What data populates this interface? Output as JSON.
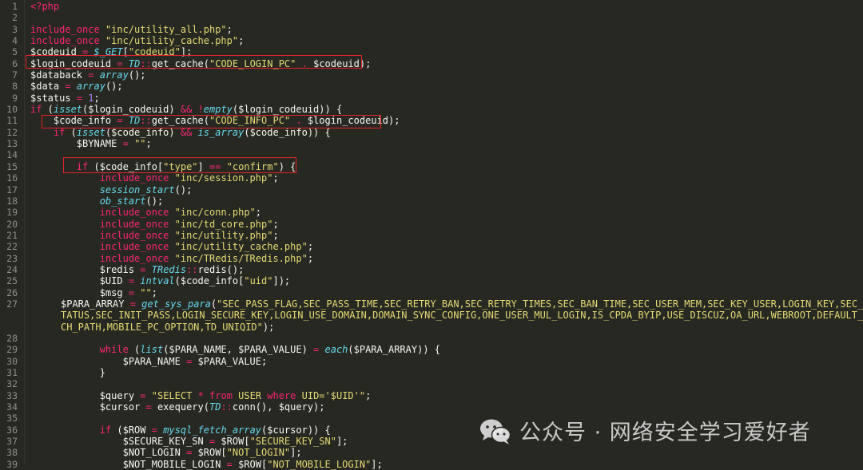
{
  "editor": {
    "language": "php",
    "lines": [
      {
        "n": "1",
        "tokens": [
          [
            "kw",
            "<?php"
          ]
        ]
      },
      {
        "n": "2",
        "tokens": []
      },
      {
        "n": "3",
        "tokens": [
          [
            "kw",
            "include_once"
          ],
          [
            "var",
            " "
          ],
          [
            "st",
            "\"inc/utility_all.php\""
          ],
          [
            "var",
            ";"
          ]
        ]
      },
      {
        "n": "4",
        "tokens": [
          [
            "kw",
            "include_once"
          ],
          [
            "var",
            " "
          ],
          [
            "st",
            "\"inc/utility_cache.php\""
          ],
          [
            "var",
            ";"
          ]
        ]
      },
      {
        "n": "5",
        "tokens": [
          [
            "var",
            "$codeuid "
          ],
          [
            "kw",
            "="
          ],
          [
            "var",
            " "
          ],
          [
            "fn",
            "$_GET"
          ],
          [
            "var",
            "["
          ],
          [
            "st",
            "\"codeuid\""
          ],
          [
            "var",
            "];"
          ]
        ]
      },
      {
        "n": "6",
        "tokens": [
          [
            "var",
            "$login_codeuid "
          ],
          [
            "kw",
            "="
          ],
          [
            "var",
            " "
          ],
          [
            "fn",
            "TD"
          ],
          [
            "kw",
            "::"
          ],
          [
            "var",
            "get_cache("
          ],
          [
            "st",
            "\"CODE_LOGIN_PC\""
          ],
          [
            "var",
            " "
          ],
          [
            "kw",
            "."
          ],
          [
            "var",
            " $codeuid);"
          ]
        ]
      },
      {
        "n": "7",
        "tokens": [
          [
            "var",
            "$databack "
          ],
          [
            "kw",
            "="
          ],
          [
            "var",
            " "
          ],
          [
            "fn",
            "array"
          ],
          [
            "var",
            "();"
          ]
        ]
      },
      {
        "n": "8",
        "tokens": [
          [
            "var",
            "$data "
          ],
          [
            "kw",
            "="
          ],
          [
            "var",
            " "
          ],
          [
            "fn",
            "array"
          ],
          [
            "var",
            "();"
          ]
        ]
      },
      {
        "n": "9",
        "tokens": [
          [
            "var",
            "$status "
          ],
          [
            "kw",
            "="
          ],
          [
            "var",
            " "
          ],
          [
            "nu",
            "1"
          ],
          [
            "var",
            ";"
          ]
        ]
      },
      {
        "n": "10",
        "tokens": [
          [
            "kw",
            "if"
          ],
          [
            "var",
            " ("
          ],
          [
            "fn",
            "isset"
          ],
          [
            "var",
            "($login_codeuid) "
          ],
          [
            "kw",
            "&&"
          ],
          [
            "var",
            " "
          ],
          [
            "kw",
            "!"
          ],
          [
            "fn",
            "empty"
          ],
          [
            "var",
            "($login_codeuid)) {"
          ]
        ]
      },
      {
        "n": "11",
        "tokens": [
          [
            "var",
            "    $code_info "
          ],
          [
            "kw",
            "="
          ],
          [
            "var",
            " "
          ],
          [
            "fn",
            "TD"
          ],
          [
            "kw",
            "::"
          ],
          [
            "var",
            "get_cache("
          ],
          [
            "st",
            "\"CODE_INFO_PC\""
          ],
          [
            "var",
            " "
          ],
          [
            "kw",
            "."
          ],
          [
            "var",
            " $login_codeuid);"
          ]
        ]
      },
      {
        "n": "12",
        "tokens": [
          [
            "var",
            "    "
          ],
          [
            "kw",
            "if"
          ],
          [
            "var",
            " ("
          ],
          [
            "fn",
            "isset"
          ],
          [
            "var",
            "($code_info) "
          ],
          [
            "kw",
            "&&"
          ],
          [
            "var",
            " "
          ],
          [
            "fn",
            "is_array"
          ],
          [
            "var",
            "($code_info)) {"
          ]
        ]
      },
      {
        "n": "13",
        "tokens": [
          [
            "var",
            "        $BYNAME "
          ],
          [
            "kw",
            "="
          ],
          [
            "var",
            " "
          ],
          [
            "st",
            "\"\""
          ],
          [
            "var",
            ";"
          ]
        ]
      },
      {
        "n": "14",
        "tokens": []
      },
      {
        "n": "15",
        "tokens": [
          [
            "var",
            "        "
          ],
          [
            "kw",
            "if"
          ],
          [
            "var",
            " ($code_info["
          ],
          [
            "st",
            "\"type\""
          ],
          [
            "var",
            "] "
          ],
          [
            "kw",
            "=="
          ],
          [
            "var",
            " "
          ],
          [
            "st",
            "\"confirm\""
          ],
          [
            "var",
            ") {"
          ]
        ]
      },
      {
        "n": "16",
        "tokens": [
          [
            "var",
            "            "
          ],
          [
            "kw",
            "include_once"
          ],
          [
            "var",
            " "
          ],
          [
            "st",
            "\"inc/session.php\""
          ],
          [
            "var",
            ";"
          ]
        ]
      },
      {
        "n": "17",
        "tokens": [
          [
            "var",
            "            "
          ],
          [
            "fn",
            "session_start"
          ],
          [
            "var",
            "();"
          ]
        ]
      },
      {
        "n": "18",
        "tokens": [
          [
            "var",
            "            "
          ],
          [
            "fn",
            "ob_start"
          ],
          [
            "var",
            "();"
          ]
        ]
      },
      {
        "n": "19",
        "tokens": [
          [
            "var",
            "            "
          ],
          [
            "kw",
            "include_once"
          ],
          [
            "var",
            " "
          ],
          [
            "st",
            "\"inc/conn.php\""
          ],
          [
            "var",
            ";"
          ]
        ]
      },
      {
        "n": "20",
        "tokens": [
          [
            "var",
            "            "
          ],
          [
            "kw",
            "include_once"
          ],
          [
            "var",
            " "
          ],
          [
            "st",
            "\"inc/td_core.php\""
          ],
          [
            "var",
            ";"
          ]
        ]
      },
      {
        "n": "21",
        "tokens": [
          [
            "var",
            "            "
          ],
          [
            "kw",
            "include_once"
          ],
          [
            "var",
            " "
          ],
          [
            "st",
            "\"inc/utility.php\""
          ],
          [
            "var",
            ";"
          ]
        ]
      },
      {
        "n": "22",
        "tokens": [
          [
            "var",
            "            "
          ],
          [
            "kw",
            "include_once"
          ],
          [
            "var",
            " "
          ],
          [
            "st",
            "\"inc/utility_cache.php\""
          ],
          [
            "var",
            ";"
          ]
        ]
      },
      {
        "n": "23",
        "tokens": [
          [
            "var",
            "            "
          ],
          [
            "kw",
            "include_once"
          ],
          [
            "var",
            " "
          ],
          [
            "st",
            "\"inc/TRedis/TRedis.php\""
          ],
          [
            "var",
            ";"
          ]
        ]
      },
      {
        "n": "24",
        "tokens": [
          [
            "var",
            "            $redis "
          ],
          [
            "kw",
            "="
          ],
          [
            "var",
            " "
          ],
          [
            "fn",
            "TRedis"
          ],
          [
            "kw",
            "::"
          ],
          [
            "var",
            "redis();"
          ]
        ]
      },
      {
        "n": "25",
        "tokens": [
          [
            "var",
            "            $UID "
          ],
          [
            "kw",
            "="
          ],
          [
            "var",
            " "
          ],
          [
            "fn",
            "intval"
          ],
          [
            "var",
            "($code_info["
          ],
          [
            "st",
            "\"uid\""
          ],
          [
            "var",
            "]);"
          ]
        ]
      },
      {
        "n": "26",
        "tokens": [
          [
            "var",
            "            $msg "
          ],
          [
            "kw",
            "="
          ],
          [
            "var",
            " "
          ],
          [
            "st",
            "\"\""
          ],
          [
            "var",
            ";"
          ]
        ]
      },
      {
        "n": "27",
        "wrap": true,
        "tokens": [
          [
            "var",
            "            $PARA_ARRAY "
          ],
          [
            "kw",
            "="
          ],
          [
            "var",
            " "
          ],
          [
            "fn",
            "get_sys_para"
          ],
          [
            "var",
            "("
          ],
          [
            "st",
            "\"SEC_PASS_FLAG,SEC_PASS_TIME,SEC_RETRY_BAN,SEC_RETRY_TIMES,SEC_BAN_TIME,SEC_USER_MEM,SEC_KEY_USER,LOGIN_KEY,SEC_ON_STATUS,SEC_INIT_PASS,LOGIN_SECURE_KEY,LOGIN_USE_DOMAIN,DOMAIN_SYNC_CONFIG,ONE_USER_MUL_LOGIN,IS_CPDA_BYIP,USE_DISCUZ,OA_URL,WEBROOT,DEFAULT_ATTACH_PATH,MOBILE_PC_OPTION,TD_UNIQID\""
          ],
          [
            "var",
            ");"
          ]
        ]
      },
      {
        "n": "28",
        "tokens": []
      },
      {
        "n": "29",
        "tokens": [
          [
            "var",
            "            "
          ],
          [
            "kw",
            "while"
          ],
          [
            "var",
            " ("
          ],
          [
            "fn",
            "list"
          ],
          [
            "var",
            "($PARA_NAME, $PARA_VALUE) "
          ],
          [
            "kw",
            "="
          ],
          [
            "var",
            " "
          ],
          [
            "fn",
            "each"
          ],
          [
            "var",
            "($PARA_ARRAY)) {"
          ]
        ]
      },
      {
        "n": "30",
        "tokens": [
          [
            "var",
            "                $PARA_NAME "
          ],
          [
            "kw",
            "="
          ],
          [
            "var",
            " $PARA_VALUE;"
          ]
        ]
      },
      {
        "n": "31",
        "tokens": [
          [
            "var",
            "            }"
          ]
        ]
      },
      {
        "n": "32",
        "tokens": []
      },
      {
        "n": "33",
        "tokens": [
          [
            "var",
            "            $query "
          ],
          [
            "kw",
            "="
          ],
          [
            "var",
            " "
          ],
          [
            "st",
            "\"SELECT "
          ],
          [
            "kw",
            "*"
          ],
          [
            "st",
            " "
          ],
          [
            "kw",
            "from"
          ],
          [
            "st",
            " USER "
          ],
          [
            "kw",
            "where"
          ],
          [
            "st",
            " UID='$UID'\""
          ],
          [
            "var",
            ";"
          ]
        ]
      },
      {
        "n": "34",
        "tokens": [
          [
            "var",
            "            $cursor "
          ],
          [
            "kw",
            "="
          ],
          [
            "var",
            " exequery("
          ],
          [
            "fn",
            "TD"
          ],
          [
            "kw",
            "::"
          ],
          [
            "var",
            "conn(), $query);"
          ]
        ]
      },
      {
        "n": "35",
        "tokens": []
      },
      {
        "n": "36",
        "tokens": [
          [
            "var",
            "            "
          ],
          [
            "kw",
            "if"
          ],
          [
            "var",
            " ($ROW "
          ],
          [
            "kw",
            "="
          ],
          [
            "var",
            " "
          ],
          [
            "fn",
            "mysql_fetch_array"
          ],
          [
            "var",
            "($cursor)) {"
          ]
        ]
      },
      {
        "n": "37",
        "tokens": [
          [
            "var",
            "                $SECURE_KEY_SN "
          ],
          [
            "kw",
            "="
          ],
          [
            "var",
            " $ROW["
          ],
          [
            "st",
            "\"SECURE_KEY_SN\""
          ],
          [
            "var",
            "];"
          ]
        ]
      },
      {
        "n": "38",
        "tokens": [
          [
            "var",
            "                $NOT_LOGIN "
          ],
          [
            "kw",
            "="
          ],
          [
            "var",
            " $ROW["
          ],
          [
            "st",
            "\"NOT_LOGIN\""
          ],
          [
            "var",
            "];"
          ]
        ]
      },
      {
        "n": "39",
        "tokens": [
          [
            "var",
            "                $NOT_MOBILE_LOGIN "
          ],
          [
            "kw",
            "="
          ],
          [
            "var",
            " $ROW["
          ],
          [
            "st",
            "\"NOT_MOBILE_LOGIN\""
          ],
          [
            "var",
            "];"
          ]
        ]
      }
    ]
  },
  "highlights": [
    {
      "line": "6",
      "color": "#e2232a"
    },
    {
      "line": "11",
      "color": "#e2232a"
    },
    {
      "line": "15",
      "color": "#e2232a"
    }
  ],
  "watermark": {
    "icon": "wechat-icon",
    "text": "公众号 · 网络安全学习爱好者"
  },
  "colors": {
    "background": "#272822",
    "keyword": "#f92672",
    "function": "#66d9ef",
    "string": "#e6db74",
    "number": "#ae81ff",
    "text": "#f8f8f2",
    "line_number": "#8f908a",
    "highlight_box": "#e2232a"
  }
}
